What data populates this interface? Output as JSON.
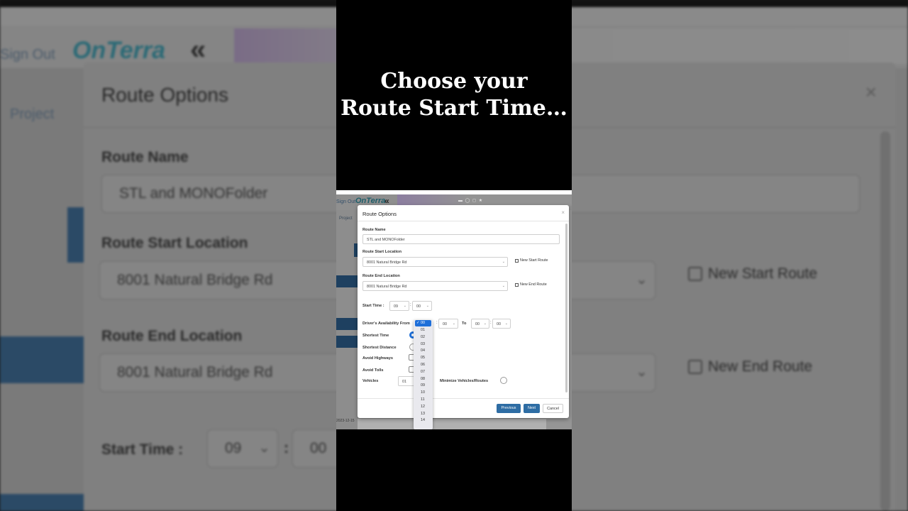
{
  "caption": {
    "line1": "Choose your",
    "line2": "Route Start Time…"
  },
  "app": {
    "sign_out": "Sign Out",
    "logo": "OnTerra",
    "collapse": "«",
    "project": "Project",
    "map_icons": "▬ ◯ ◻ ★",
    "date": "2023-12-15"
  },
  "dialog": {
    "title": "Route Options",
    "close": "×",
    "route_name_label": "Route Name",
    "route_name_value": "STL and MONOFolder",
    "start_location_label": "Route Start Location",
    "start_location_value": "8001 Natural Bridge Rd",
    "new_start_route": "New Start Route",
    "end_location_label": "Route End Location",
    "end_location_value": "8001 Natural Bridge Rd",
    "new_end_route": "New End Route",
    "start_time_label": "Start Time :",
    "start_hour": "09",
    "start_minute": "00",
    "colon": ":",
    "availability_label": "Driver's Availability From",
    "avail_from_minute": "00",
    "to_label": "To",
    "avail_to_hour": "00",
    "avail_to_minute": "00",
    "shortest_time": "Shortest Time",
    "shortest_distance": "Shortest Distance",
    "avoid_highways": "Avoid Highways",
    "avoid_tolls": "Avoid Tolls",
    "vehicles_label": "Vehicles",
    "vehicles_value": "01",
    "minimize_label": "Minimize Vehicles/Routes",
    "previous": "Previous",
    "next": "Next",
    "cancel": "Cancel"
  },
  "dropdown": {
    "selected": "✓ 00",
    "options": [
      "01",
      "02",
      "03",
      "04",
      "05",
      "06",
      "07",
      "08",
      "09",
      "10",
      "11",
      "12",
      "13",
      "14"
    ]
  },
  "background": {
    "title": "Route Options",
    "close": "×",
    "project": "Project",
    "sign_out": "Sign Out",
    "logo": "OnTerra",
    "collapse": "«",
    "route_name_label": "Route Name",
    "route_name_value": "STL and MONOFolder",
    "start_location_label": "Route Start Location",
    "start_location_value": "8001 Natural Bridge Rd",
    "new_start_route": "New Start Route",
    "end_location_label": "Route End Location",
    "end_location_value": "8001 Natural Bridge Rd",
    "new_end_route": "New End Route",
    "start_time_label": "Start Time :",
    "start_hour": "09",
    "start_minute": "00",
    "colon": ":"
  },
  "colors": {
    "primary_button": "#2e6da4",
    "selected_option": "#1e6fd9",
    "sidebar_blue": "#1e4060"
  }
}
